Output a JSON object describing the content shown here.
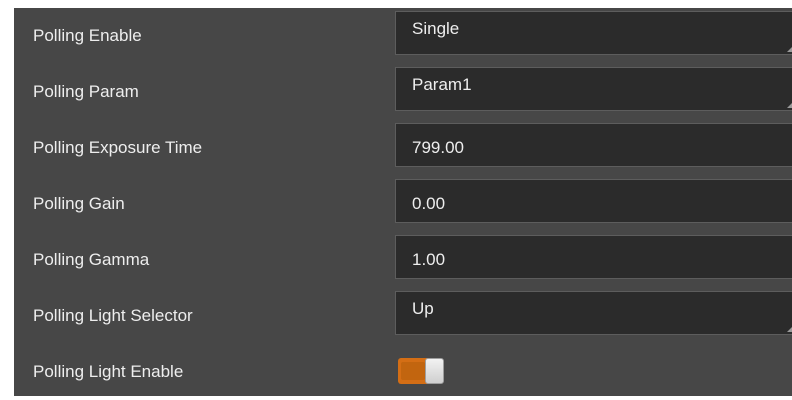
{
  "rows": [
    {
      "label": "Polling Enable",
      "type": "dropdown",
      "value": "Single"
    },
    {
      "label": "Polling Param",
      "type": "dropdown",
      "value": "Param1"
    },
    {
      "label": "Polling Exposure Time",
      "type": "number",
      "value": "799.00"
    },
    {
      "label": "Polling Gain",
      "type": "number",
      "value": "0.00"
    },
    {
      "label": "Polling Gamma",
      "type": "number",
      "value": "1.00"
    },
    {
      "label": "Polling Light Selector",
      "type": "dropdown",
      "value": "Up"
    },
    {
      "label": "Polling Light Enable",
      "type": "toggle",
      "on": true
    }
  ],
  "colors": {
    "panel_bg": "#474747",
    "field_bg": "#2b2b2b",
    "toggle_accent": "#d46e15"
  },
  "icons": {
    "dropdown_indicator": "dropdown-corner-icon"
  }
}
